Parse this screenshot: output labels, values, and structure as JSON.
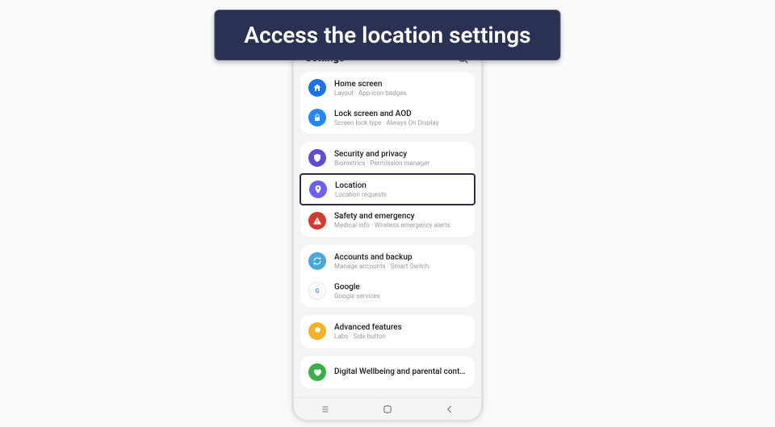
{
  "instruction": "Access the location settings",
  "header": {
    "title": "Settings"
  },
  "groups": [
    {
      "items": [
        {
          "icon": "home",
          "bg": "bg-blue-dark",
          "title": "Home screen",
          "sub": "Layout · App icon badges"
        },
        {
          "icon": "lock",
          "bg": "bg-blue",
          "title": "Lock screen and AOD",
          "sub": "Screen lock type · Always On Display"
        }
      ]
    },
    {
      "items": [
        {
          "icon": "shield",
          "bg": "bg-purple",
          "title": "Security and privacy",
          "sub": "Biometrics · Permission manager"
        },
        {
          "icon": "pin",
          "bg": "bg-indigo",
          "title": "Location",
          "sub": "Location requests",
          "highlight": true
        },
        {
          "icon": "alert",
          "bg": "bg-red",
          "title": "Safety and emergency",
          "sub": "Medical info · Wireless emergency alerts"
        }
      ]
    },
    {
      "items": [
        {
          "icon": "sync",
          "bg": "bg-cyan",
          "title": "Accounts and backup",
          "sub": "Manage accounts · Smart Switch"
        },
        {
          "icon": "google",
          "bg": "bg-white",
          "title": "Google",
          "sub": "Google services"
        }
      ]
    },
    {
      "items": [
        {
          "icon": "gear",
          "bg": "bg-gold",
          "title": "Advanced features",
          "sub": "Labs · Side button"
        }
      ]
    },
    {
      "items": [
        {
          "icon": "heart",
          "bg": "bg-green",
          "title": "Digital Wellbeing and parental controls",
          "sub": ""
        }
      ]
    }
  ]
}
